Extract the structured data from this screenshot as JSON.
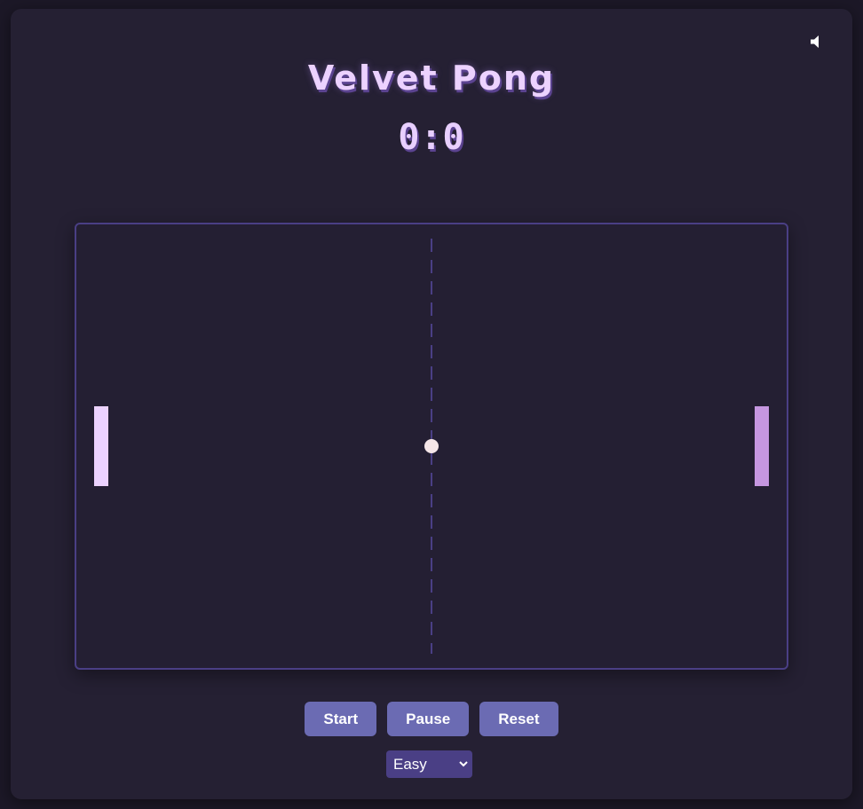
{
  "header": {
    "title": "Velvet Pong",
    "score": "0:0"
  },
  "sound": {
    "icon": "speaker-icon"
  },
  "controls": {
    "start_label": "Start",
    "pause_label": "Pause",
    "reset_label": "Reset"
  },
  "difficulty": {
    "selected": "Easy"
  },
  "colors": {
    "left_paddle": "#ecd2ff",
    "right_paddle": "#c596e0",
    "ball": "#f5e6e8",
    "center_line": "#4a3f85",
    "button": "#6b6bb3",
    "select": "#4a3f85"
  }
}
